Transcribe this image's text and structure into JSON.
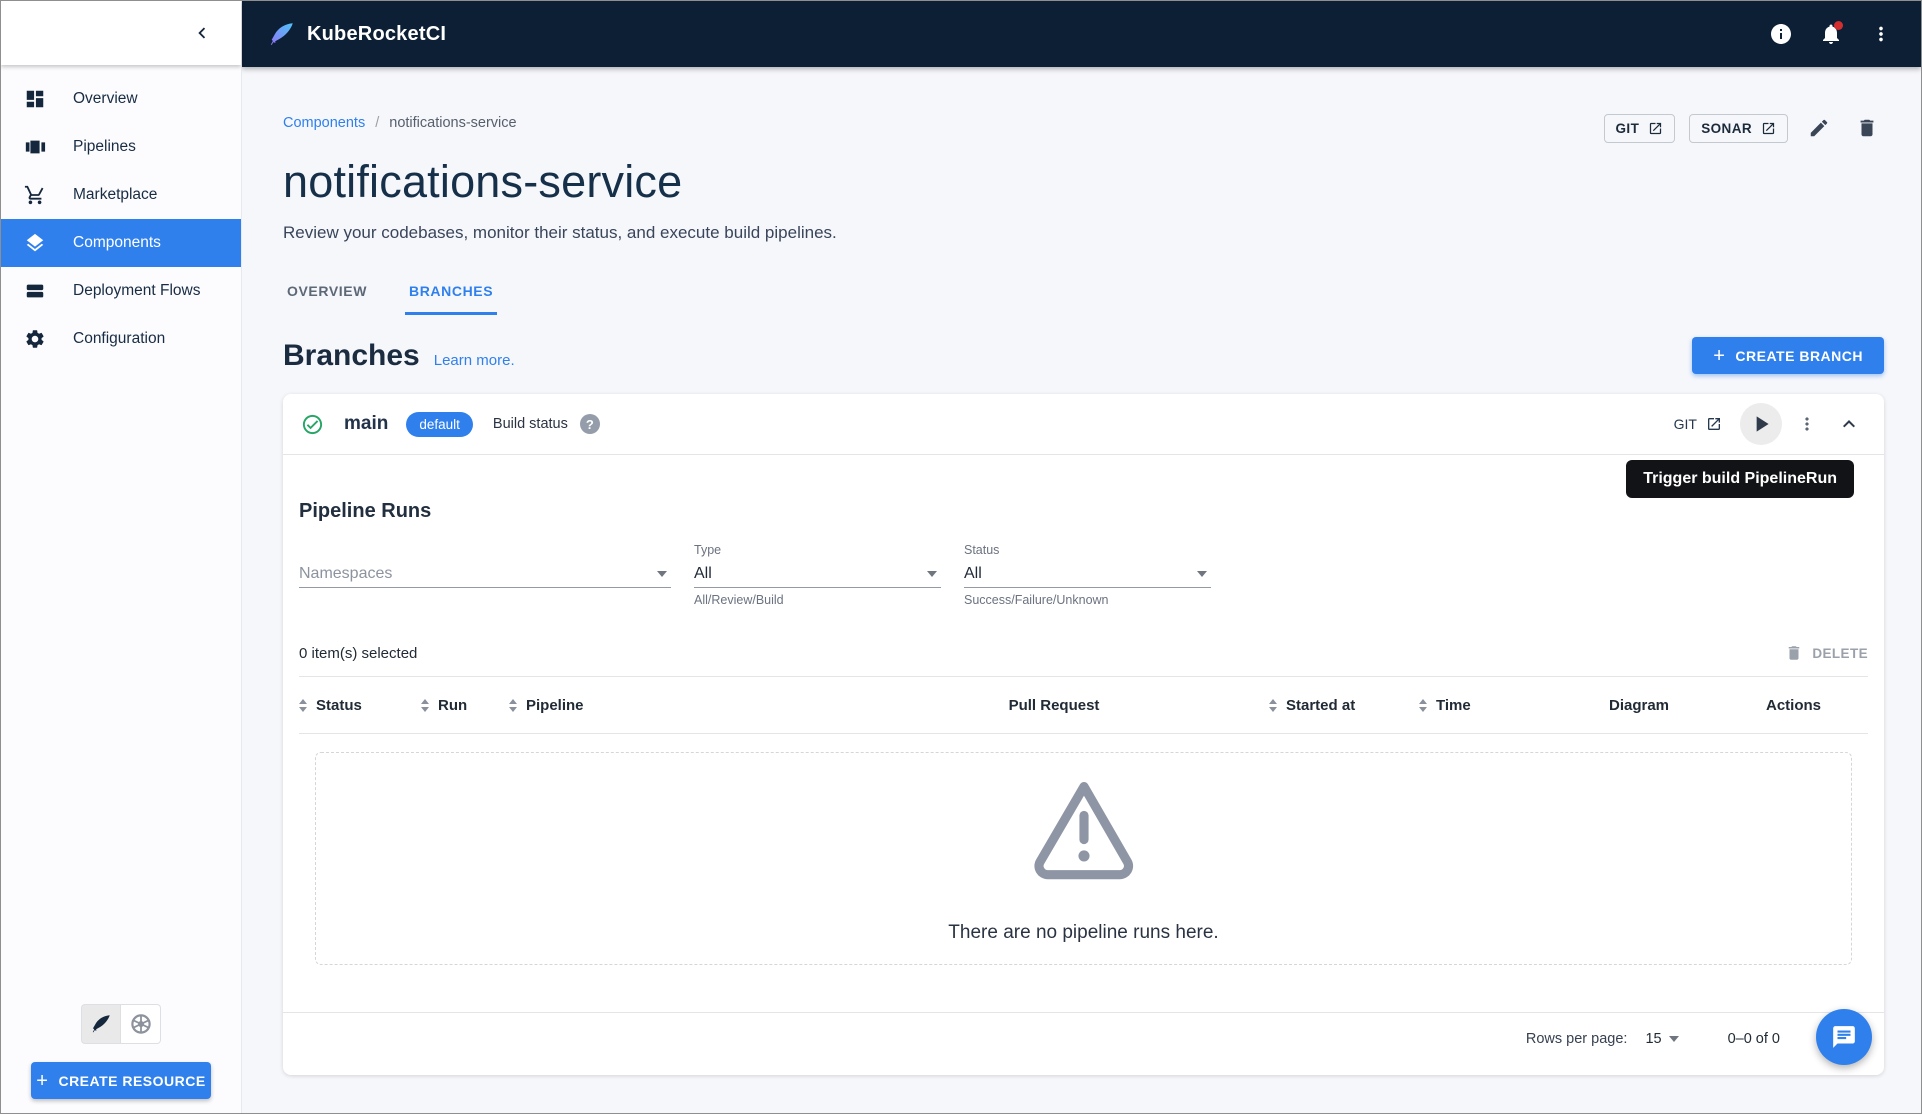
{
  "topbar": {
    "app_name": "KubeRocketCI"
  },
  "sidebar": {
    "items": [
      {
        "label": "Overview"
      },
      {
        "label": "Pipelines"
      },
      {
        "label": "Marketplace"
      },
      {
        "label": "Components"
      },
      {
        "label": "Deployment Flows"
      },
      {
        "label": "Configuration"
      }
    ],
    "create_resource_label": "CREATE RESOURCE"
  },
  "breadcrumb": {
    "parent": "Components",
    "separator": "/",
    "current": "notifications-service"
  },
  "header": {
    "title": "notifications-service",
    "description": "Review your codebases, monitor their status, and execute build pipelines.",
    "git_button": "GIT",
    "sonar_button": "SONAR"
  },
  "tabs": {
    "overview": "OVERVIEW",
    "branches": "BRANCHES"
  },
  "branches_section": {
    "heading": "Branches",
    "learn_more": "Learn more.",
    "create_branch_button": "CREATE BRANCH"
  },
  "branch": {
    "name": "main",
    "default_chip": "default",
    "build_status_label": "Build status",
    "help_glyph": "?",
    "git_link": "GIT",
    "tooltip": "Trigger build PipelineRun"
  },
  "pipeline_runs": {
    "heading": "Pipeline Runs",
    "filters": {
      "namespaces_placeholder": "Namespaces",
      "type": {
        "label": "Type",
        "value": "All",
        "helper": "All/Review/Build"
      },
      "status": {
        "label": "Status",
        "value": "All",
        "helper": "Success/Failure/Unknown"
      }
    },
    "selected_text": "0 item(s) selected",
    "delete_label": "DELETE",
    "table": {
      "columns": [
        {
          "label": "Status"
        },
        {
          "label": "Run"
        },
        {
          "label": "Pipeline"
        },
        {
          "label": "Pull Request"
        },
        {
          "label": "Started at"
        },
        {
          "label": "Time"
        },
        {
          "label": "Diagram"
        },
        {
          "label": "Actions"
        }
      ]
    },
    "empty_message": "There are no pipeline runs here.",
    "pagination": {
      "rows_per_page_label": "Rows per page:",
      "rows_per_page_value": "15",
      "range": "0–0 of 0"
    }
  },
  "colors": {
    "primary": "#2f80ed",
    "topbar_bg": "#0d1f35",
    "success_check": "#27a567",
    "warning_icon": "#8e96a5",
    "tooltip_bg": "#121316",
    "notification_dot": "#d32f2f"
  }
}
